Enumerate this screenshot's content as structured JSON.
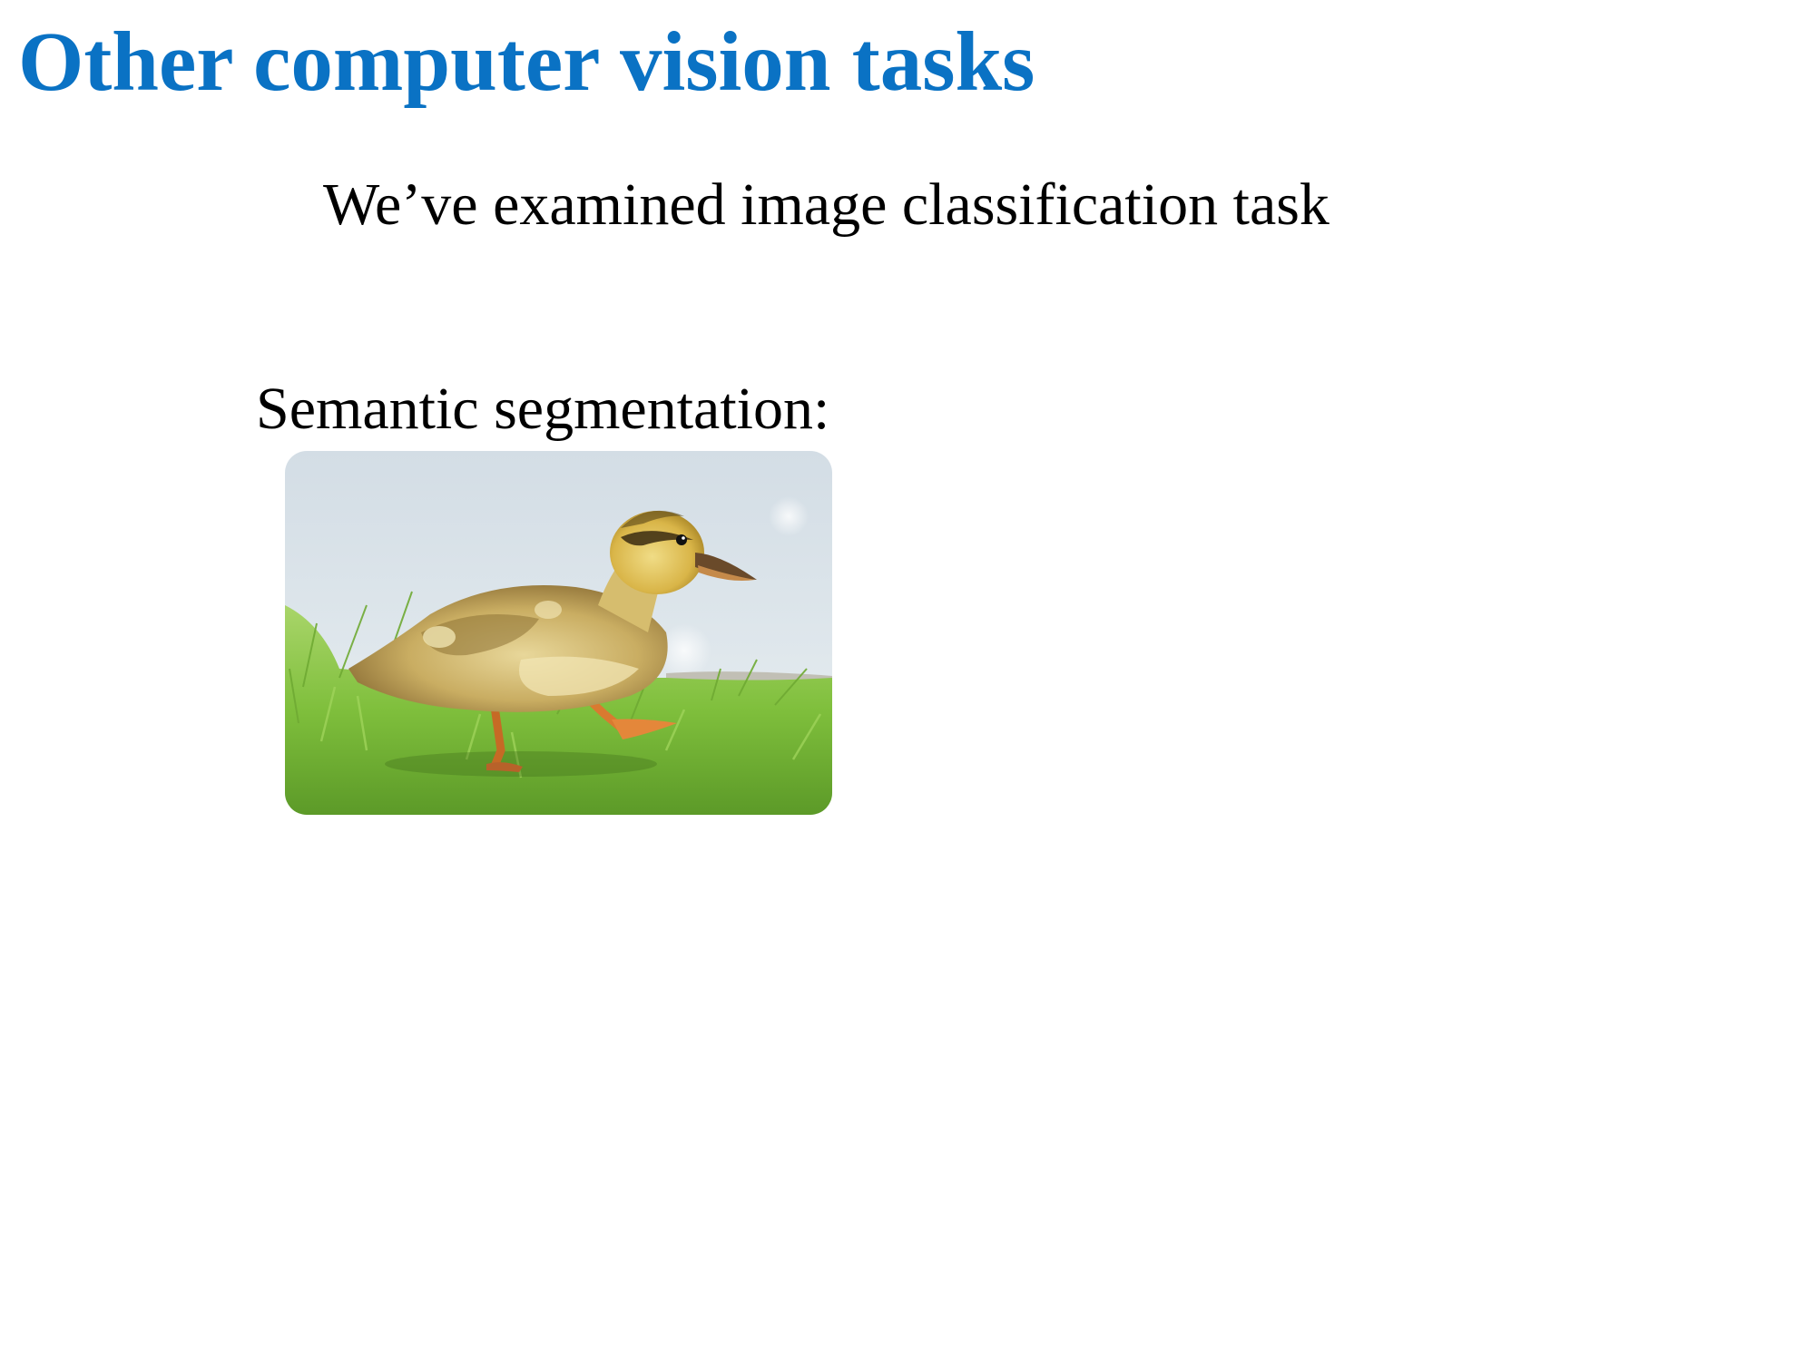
{
  "slide": {
    "title": "Other computer vision tasks",
    "intro_text": "We’ve examined image classification task",
    "segmentation_label": "Semantic segmentation:",
    "colors": {
      "title": "#0A72C4",
      "body_text": "#000000",
      "background": "#FFFFFF"
    }
  },
  "photo": {
    "subject": "duckling-on-grass"
  }
}
